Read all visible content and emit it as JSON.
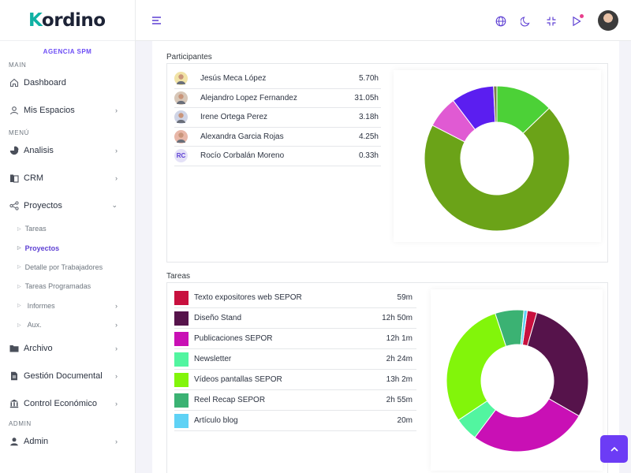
{
  "app": {
    "logo_text": "ordino",
    "logo_k": "K",
    "agency": "AGENCIA SPM"
  },
  "sidebar": {
    "sections": {
      "main": "MAIN",
      "menu": "MENÚ",
      "admin": "ADMIN"
    },
    "items": {
      "dashboard": "Dashboard",
      "mis_espacios": "Mis Espacios",
      "analisis": "Analisis",
      "crm": "CRM",
      "proyectos": "Proyectos",
      "archivo": "Archivo",
      "gestion": "Gestión Documental",
      "control": "Control Económico",
      "admin": "Admin"
    },
    "subitems": {
      "tareas": "Tareas",
      "proyectos": "Proyectos",
      "detalle": "Detalle por Trabajadores",
      "programadas": "Tareas Programadas",
      "informes": "Informes",
      "aux": "Aux."
    }
  },
  "participantes": {
    "title": "Participantes",
    "rows": [
      {
        "name": "Jesús Meca López",
        "hours": "5.70h",
        "avatar": "photo",
        "color": "#f1e3a6"
      },
      {
        "name": "Alejandro Lopez Fernandez",
        "hours": "31.05h",
        "avatar": "photo",
        "color": "#d7c7b8"
      },
      {
        "name": "Irene Ortega Perez",
        "hours": "3.18h",
        "avatar": "photo",
        "color": "#cfd4e6"
      },
      {
        "name": "Alexandra Garcia Rojas",
        "hours": "4.25h",
        "avatar": "photo",
        "color": "#e8b7a8"
      },
      {
        "name": "Rocío Corbalán Moreno",
        "hours": "0.33h",
        "avatar": "RC",
        "color": "#e4e1f7"
      }
    ],
    "chart_data": {
      "type": "pie",
      "values": [
        5.7,
        31.05,
        3.18,
        4.25,
        0.33
      ],
      "colors": [
        "#4cd137",
        "#6ba318",
        "#e05ad3",
        "#5b1ef0",
        "#7b7f4a"
      ],
      "start_index": 0
    }
  },
  "tareas": {
    "title": "Tareas",
    "rows": [
      {
        "name": "Texto expositores web SEPOR",
        "time": "59m",
        "color": "#c8103e"
      },
      {
        "name": "Diseño Stand",
        "time": "12h 50m",
        "color": "#56134b"
      },
      {
        "name": "Publicaciones SEPOR",
        "time": "12h 1m",
        "color": "#c910b5"
      },
      {
        "name": "Newsletter",
        "time": "2h 24m",
        "color": "#52f5a0"
      },
      {
        "name": "Vídeos pantallas SEPOR",
        "time": "13h 2m",
        "color": "#82f50a"
      },
      {
        "name": "Reel Recap SEPOR",
        "time": "2h 55m",
        "color": "#3bb273"
      },
      {
        "name": "Artículo blog",
        "time": "20m",
        "color": "#5fd2f5"
      }
    ],
    "chart_data": {
      "type": "pie",
      "values": [
        59,
        770,
        721,
        144,
        782,
        175,
        20
      ],
      "colors": [
        "#c8103e",
        "#56134b",
        "#c910b5",
        "#52f5a0",
        "#82f50a",
        "#3bb273",
        "#5fd2f5"
      ]
    }
  },
  "icons": {
    "globe": "globe-icon",
    "moon": "moon-icon",
    "fullscreen": "fullscreen-exit-icon",
    "notifications": "play-icon"
  }
}
